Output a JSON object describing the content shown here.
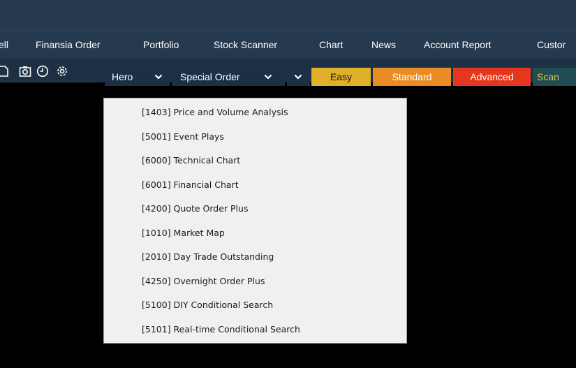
{
  "menubar": {
    "items": [
      {
        "label": "ell"
      },
      {
        "label": "Finansia Order"
      },
      {
        "label": "Portfolio"
      },
      {
        "label": "Stock Scanner"
      },
      {
        "label": "Chart"
      },
      {
        "label": "News"
      },
      {
        "label": "Account Report"
      },
      {
        "label": "Custor"
      }
    ]
  },
  "toolbar": {
    "icons": [
      "document-icon",
      "camera-icon",
      "clock-icon",
      "gear-icon"
    ],
    "hero_label": "Hero",
    "special_order_label": "Special Order",
    "easy_label": "Easy",
    "standard_label": "Standard",
    "advanced_label": "Advanced",
    "scan_label": "Scan",
    "colors": {
      "easy": "#e0b02a",
      "standard": "#ea8c24",
      "advanced": "#e5371e",
      "scan": "#214d52",
      "bar": "#263a4f"
    }
  },
  "dropdown": {
    "items": [
      {
        "label": "[1403] Price and Volume Analysis"
      },
      {
        "label": "[5001] Event Plays"
      },
      {
        "label": "[6000] Technical Chart"
      },
      {
        "label": "[6001] Financial Chart"
      },
      {
        "label": "[4200] Quote Order Plus"
      },
      {
        "label": "[1010] Market Map"
      },
      {
        "label": "[2010] Day Trade Outstanding"
      },
      {
        "label": "[4250] Overnight Order Plus"
      },
      {
        "label": "[5100] DIY Conditional Search"
      },
      {
        "label": "[5101] Real-time Conditional Search"
      }
    ]
  }
}
